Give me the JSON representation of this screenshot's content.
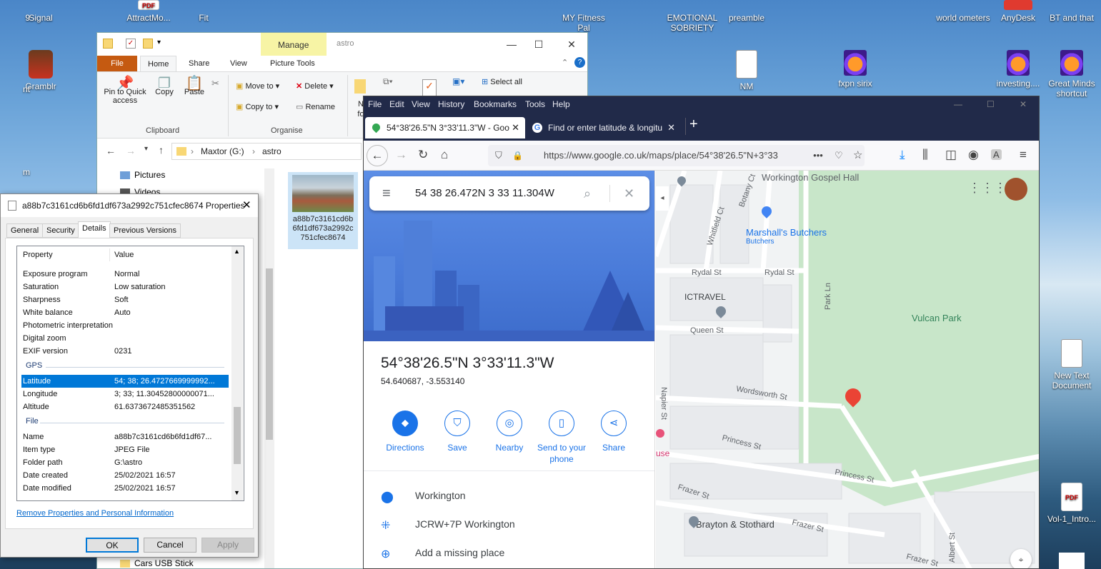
{
  "desktop": {
    "icons_top": [
      "Signal",
      "AttractMo...",
      "Fit",
      "MY Fitness Pal",
      "EMOTIONAL SOBRIETY",
      "preamble",
      "world ometers",
      "AnyDesk",
      "BT and that"
    ],
    "icons_second": [
      "Gramblr",
      "NM",
      "fxpn sirix",
      "investing....",
      "Great Minds shortcut"
    ],
    "icons_right": [
      "New Text Document",
      "Vol-1_Intro..."
    ],
    "left_partial": [
      "9",
      "5 ...",
      "nt",
      "m"
    ],
    "pdf_badge": "PDF"
  },
  "explorer": {
    "manage_tab": "Manage",
    "folder_title": "astro",
    "tabs": [
      "File",
      "Home",
      "Share",
      "View",
      "Picture Tools"
    ],
    "clipboard": {
      "pin": "Pin to Quick access",
      "copy": "Copy",
      "paste": "Paste",
      "group": "Clipboard"
    },
    "organise": {
      "move_to": "Move to",
      "copy_to": "Copy to",
      "delete": "Delete",
      "rename": "Rename",
      "group": "Organise"
    },
    "select_all": "Select all",
    "new_folder_partial": "N fo",
    "breadcrumb": [
      "Maxtor (G:)",
      "astro"
    ],
    "tree": [
      "Pictures",
      "Videos",
      "Cars USB Stick"
    ],
    "file_thumb_name": "a88b7c3161cd6b6fd1df673a2992c751cfec8674"
  },
  "properties": {
    "title": "a88b7c3161cd6b6fd1df673a2992c751cfec8674 Properties",
    "tabs": [
      "General",
      "Security",
      "Details",
      "Previous Versions"
    ],
    "col_property": "Property",
    "col_value": "Value",
    "rows_top": [
      {
        "k": "Exposure program",
        "v": "Normal"
      },
      {
        "k": "Saturation",
        "v": "Low saturation"
      },
      {
        "k": "Sharpness",
        "v": "Soft"
      },
      {
        "k": "White balance",
        "v": "Auto"
      },
      {
        "k": "Photometric interpretation",
        "v": ""
      },
      {
        "k": "Digital zoom",
        "v": ""
      },
      {
        "k": "EXIF version",
        "v": "0231"
      }
    ],
    "group_gps": "GPS",
    "rows_gps": [
      {
        "k": "Latitude",
        "v": "54; 38; 26.4727669999992..."
      },
      {
        "k": "Longitude",
        "v": "3; 33; 11.30452800000071..."
      },
      {
        "k": "Altitude",
        "v": "61.6373672485351562"
      }
    ],
    "group_file": "File",
    "rows_file": [
      {
        "k": "Name",
        "v": "a88b7c3161cd6b6fd1df67..."
      },
      {
        "k": "Item type",
        "v": "JPEG File"
      },
      {
        "k": "Folder path",
        "v": "G:\\astro"
      },
      {
        "k": "Date created",
        "v": "25/02/2021 16:57"
      },
      {
        "k": "Date modified",
        "v": "25/02/2021 16:57"
      }
    ],
    "remove_link": "Remove Properties and Personal Information",
    "ok": "OK",
    "cancel": "Cancel",
    "apply": "Apply"
  },
  "firefox": {
    "menu": [
      "File",
      "Edit",
      "View",
      "History",
      "Bookmarks",
      "Tools",
      "Help"
    ],
    "tab1": "54°38'26.5\"N 3°33'11.3\"W - Goo",
    "tab2": "Find or enter latitude & longitu",
    "url": "https://www.google.co.uk/maps/place/54°38'26.5\"N+3°33",
    "more": "•••"
  },
  "maps": {
    "search_value": "54 38 26.472N 3 33 11.304W",
    "coord_title": "54°38'26.5\"N 3°33'11.3\"W",
    "coord_decimal": "54.640687, -3.553140",
    "actions": [
      "Directions",
      "Save",
      "Nearby",
      "Send to your phone",
      "Share"
    ],
    "info": [
      "Workington",
      "JCRW+7P Workington",
      "Add a missing place"
    ],
    "labels": {
      "gospel": "Workington Gospel Hall",
      "butchers": "Marshall's Butchers",
      "butchers_sub": "Butchers",
      "ictravel": "ICTRAVEL",
      "park": "Vulcan Park",
      "brayton": "Brayton & Stothard",
      "rydal1": "Rydal St",
      "rydal2": "Rydal St",
      "queen": "Queen St",
      "wordsworth": "Wordsworth St",
      "princess1": "Princess St",
      "princess2": "Princess St",
      "frazer1": "Frazer St",
      "frazer2": "Frazer St",
      "frazer3": "Frazer St",
      "parkln": "Park Ln",
      "whitfield": "Whitfield Ct",
      "botany": "Botany Ct",
      "napier": "Napier St",
      "albert": "Albert St",
      "use": "use"
    }
  },
  "colors": {
    "accent": "#1a73e8",
    "pin": "#ea4335",
    "ff_dark": "#212a49",
    "manage": "#f7f4a5",
    "file_tab": "#c55a11"
  }
}
